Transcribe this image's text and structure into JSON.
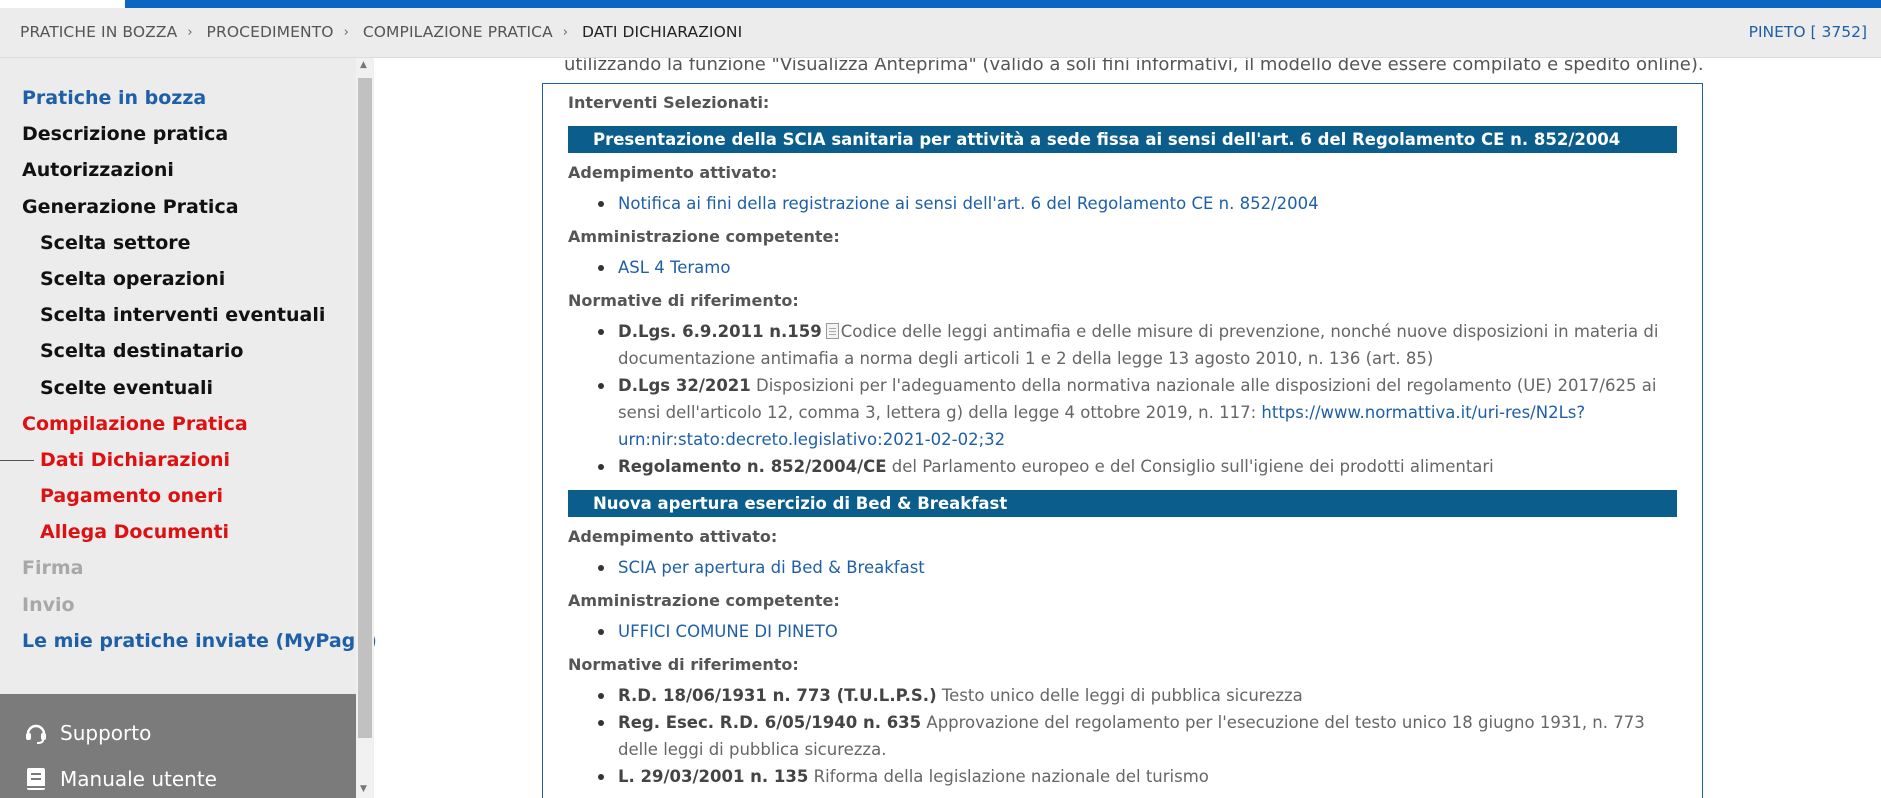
{
  "breadcrumb": {
    "items": [
      "PRATICHE IN BOZZA",
      "PROCEDIMENTO",
      "COMPILAZIONE PRATICA",
      "DATI DICHIARAZIONI"
    ],
    "comune": "PINETO [ 3752]"
  },
  "sidebar": {
    "items": [
      {
        "label": "Pratiche in bozza"
      },
      {
        "label": "Descrizione pratica"
      },
      {
        "label": "Autorizzazioni"
      },
      {
        "label": "Generazione Pratica"
      },
      {
        "label": "Scelta settore"
      },
      {
        "label": "Scelta operazioni"
      },
      {
        "label": "Scelta interventi eventuali"
      },
      {
        "label": "Scelta destinatario"
      },
      {
        "label": "Scelte eventuali"
      },
      {
        "label": "Compilazione Pratica"
      },
      {
        "label": "Dati Dichiarazioni"
      },
      {
        "label": "Pagamento oneri"
      },
      {
        "label": "Allega Documenti"
      },
      {
        "label": "Firma"
      },
      {
        "label": "Invio"
      },
      {
        "label": "Le mie pratiche inviate (MyPage)"
      }
    ],
    "support": {
      "supporto": "Supporto",
      "manuale": "Manuale utente"
    }
  },
  "main": {
    "intro": "utilizzando la funzione \"Visualizza Anteprima\" (valido a soli fini informativi, il modello deve essere compilato e spedito online).",
    "box_title": "Interventi Selezionati:",
    "labels": {
      "adempimento": "Adempimento attivato:",
      "amministrazione": "Amministrazione competente:",
      "normative": "Normative di riferimento:"
    },
    "interventi": [
      {
        "title": "Presentazione della SCIA sanitaria per attività a sede fissa ai sensi dell'art. 6 del Regolamento CE n. 852/2004",
        "adempimento": "Notifica ai fini della registrazione ai sensi dell'art. 6 del Regolamento CE n. 852/2004",
        "amministrazione": "ASL 4 Teramo",
        "normative": [
          {
            "ref": "D.Lgs. 6.9.2011 n.159",
            "text": "Codice delle leggi antimafia e delle misure di prevenzione, nonché nuove disposizioni in materia di documentazione antimafia a norma degli articoli 1 e 2 della legge 13 agosto 2010, n. 136 (art. 85)"
          },
          {
            "ref": "D.Lgs 32/2021",
            "text": "Disposizioni per l'adeguamento della normativa nazionale alle disposizioni del regolamento (UE) 2017/625 ai sensi dell'articolo 12, comma 3, lettera g) della legge 4 ottobre 2019, n. 117:",
            "link": "https://www.normattiva.it/uri-res/N2Ls?urn:nir:stato:decreto.legislativo:2021-02-02;32"
          },
          {
            "ref": "Regolamento n. 852/2004/CE",
            "text": "del Parlamento europeo e del Consiglio sull'igiene dei prodotti alimentari"
          }
        ]
      },
      {
        "title": "Nuova apertura esercizio di Bed & Breakfast",
        "adempimento": "SCIA per apertura di Bed & Breakfast",
        "amministrazione": "UFFICI COMUNE DI PINETO",
        "normative": [
          {
            "ref": "R.D. 18/06/1931 n. 773 (T.U.L.P.S.)",
            "text": "Testo unico delle leggi di pubblica sicurezza"
          },
          {
            "ref": "Reg. Esec. R.D. 6/05/1940 n. 635",
            "text": "Approvazione del regolamento per l'esecuzione del testo unico 18 giugno 1931, n. 773 delle leggi di pubblica sicurezza."
          },
          {
            "ref": "L. 29/03/2001 n. 135",
            "text": "Riforma della legislazione nazionale del turismo"
          }
        ]
      }
    ]
  },
  "colors": {
    "accent": "#0a66c2",
    "section_bar": "#0b5e8c",
    "link": "#1e5fa8",
    "active": "#dd1111"
  }
}
